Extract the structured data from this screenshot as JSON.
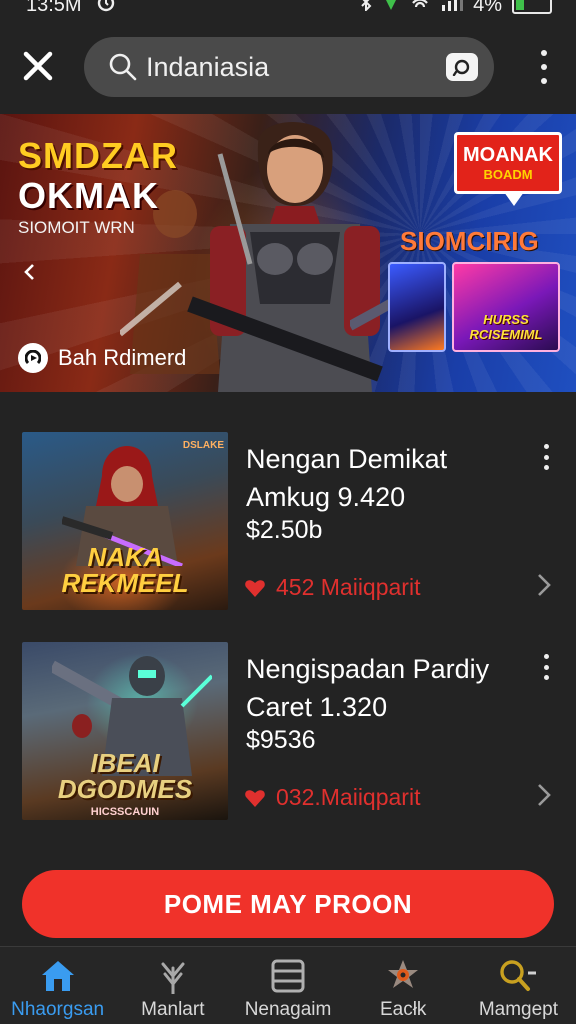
{
  "status_bar": {
    "time": "13:5M",
    "battery": "4%"
  },
  "search": {
    "query": "Indaniasia"
  },
  "banner": {
    "title_line1": "SMDZAR",
    "title_line2": "OKMAK",
    "subtitle": "SIOMOIT WRN",
    "cta_label": "Bah Rdimerd",
    "badge_line1": "MOANAK",
    "badge_line2": "BOADM",
    "promo_text": "SIOMCIRIG",
    "thumb_label": "HURSS RCISEMIML"
  },
  "items": [
    {
      "title": "Nengan Demikat Amkug 9.420",
      "price": "$2.50b",
      "likes": "452 Maiiqparit",
      "art_title": "NAKA REKMEEL",
      "art_tag": "DSLAKE"
    },
    {
      "title": "Nengispadan Pardiy Caret 1.320",
      "price": "$9536",
      "likes": "032.Maiiqparit",
      "art_title": "IBEAI DGODMES",
      "art_caption": "HICSSCAUIN"
    }
  ],
  "primary_button": {
    "label": "POME MAY PROON"
  },
  "bottom_nav": [
    {
      "label": "Nhaorgsan",
      "icon": "home-icon",
      "active": true
    },
    {
      "label": "Manlart",
      "icon": "plant-icon",
      "active": false
    },
    {
      "label": "Nenagaim",
      "icon": "list-icon",
      "active": false
    },
    {
      "label": "Eacłk",
      "icon": "badge-icon",
      "active": false
    },
    {
      "label": "Mamgept",
      "icon": "search-minus-icon",
      "active": false
    }
  ],
  "colors": {
    "background": "#232323",
    "accent_red": "#f0322a",
    "active_nav": "#3a9cf0",
    "search_field": "#4a4a4a"
  }
}
